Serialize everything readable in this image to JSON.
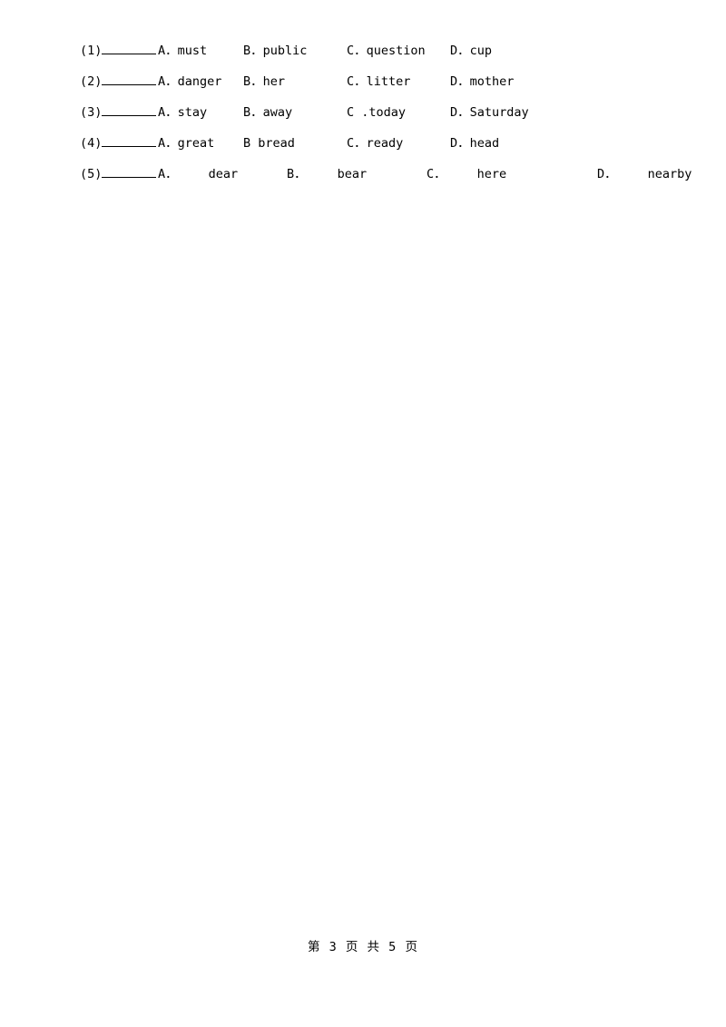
{
  "page": {
    "footer": "第 3 页 共 5 页"
  },
  "questions": [
    {
      "number": "(1)",
      "options": [
        {
          "label": "A．",
          "word": "must"
        },
        {
          "label": "B．",
          "word": "public"
        },
        {
          "label": "C．",
          "word": "question"
        },
        {
          "label": "D．",
          "word": "cup"
        }
      ]
    },
    {
      "number": "(2)",
      "options": [
        {
          "label": "A．",
          "word": "danger"
        },
        {
          "label": "B．",
          "word": "her"
        },
        {
          "label": "C．",
          "word": "litter"
        },
        {
          "label": "D．",
          "word": "mother"
        }
      ]
    },
    {
      "number": "(3)",
      "options": [
        {
          "label": "A．",
          "word": "stay"
        },
        {
          "label": "B．",
          "word": "away"
        },
        {
          "label": "C .",
          "word": "today"
        },
        {
          "label": "D．",
          "word": "Saturday"
        }
      ]
    },
    {
      "number": "(4)",
      "options": [
        {
          "label": "A．",
          "word": "great"
        },
        {
          "label": "B",
          "word": "bread"
        },
        {
          "label": "C．",
          "word": "ready"
        },
        {
          "label": "D．",
          "word": "head"
        }
      ]
    },
    {
      "number": "(5)",
      "options": [
        {
          "label": "A．",
          "word": "dear"
        },
        {
          "label": "B．",
          "word": "bear"
        },
        {
          "label": "C．",
          "word": "here"
        },
        {
          "label": "D．",
          "word": "nearby"
        }
      ]
    }
  ]
}
